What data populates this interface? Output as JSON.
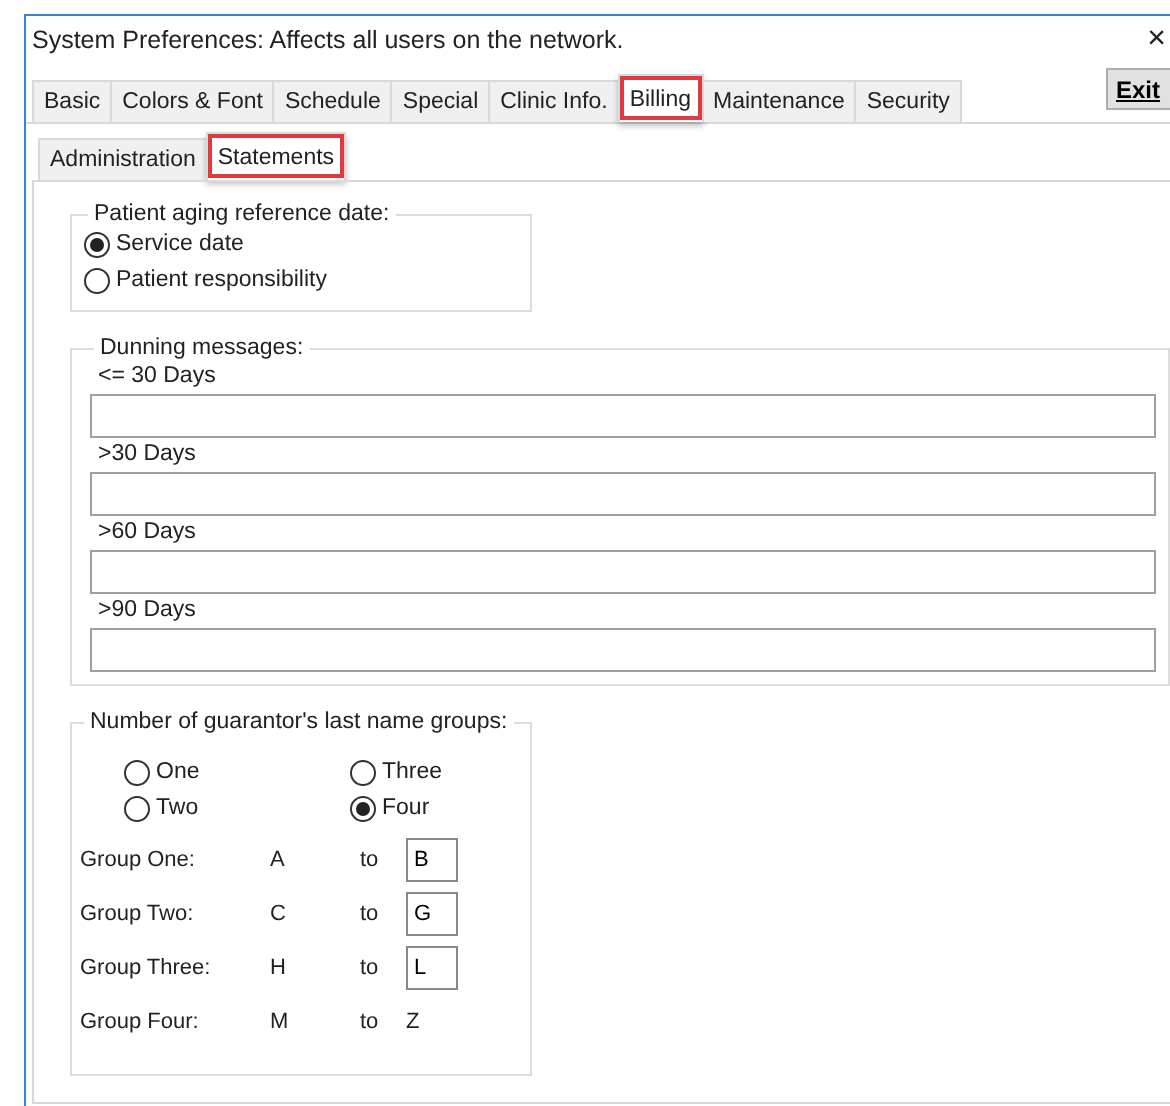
{
  "window": {
    "title": "System Preferences: Affects all users on the network.",
    "close": "×"
  },
  "tabs": [
    {
      "label": "Basic",
      "selected": false,
      "highlighted": false
    },
    {
      "label": "Colors & Font",
      "selected": false,
      "highlighted": false
    },
    {
      "label": "Schedule",
      "selected": false,
      "highlighted": false
    },
    {
      "label": "Special",
      "selected": false,
      "highlighted": false
    },
    {
      "label": "Clinic Info.",
      "selected": false,
      "highlighted": false
    },
    {
      "label": "Billing",
      "selected": true,
      "highlighted": true
    },
    {
      "label": "Maintenance",
      "selected": false,
      "highlighted": false
    },
    {
      "label": "Security",
      "selected": false,
      "highlighted": false
    }
  ],
  "exit_button": "Exit",
  "subtabs": [
    {
      "label": "Administration",
      "selected": false,
      "highlighted": false
    },
    {
      "label": "Statements",
      "selected": true,
      "highlighted": true
    }
  ],
  "aging": {
    "title": "Patient aging reference date:",
    "options": [
      {
        "label": "Service date",
        "selected": true
      },
      {
        "label": "Patient responsibility",
        "selected": false
      }
    ]
  },
  "dunning": {
    "title": "Dunning messages:",
    "messages": [
      {
        "label": "<= 30 Days"
      },
      {
        "label": ">30 Days"
      },
      {
        "label": ">60 Days"
      },
      {
        "label": ">90 Days"
      }
    ]
  },
  "groups": {
    "title": "Number of guarantor's last name groups:",
    "options": [
      {
        "label": "One",
        "selected": false
      },
      {
        "label": "Three",
        "selected": false
      },
      {
        "label": "Two",
        "selected": false
      },
      {
        "label": "Four",
        "selected": true
      }
    ],
    "rows": [
      {
        "label": "Group One:",
        "from": "A",
        "to_label": "to",
        "to": "B",
        "kind": "field"
      },
      {
        "label": "Group Two:",
        "from": "C",
        "to_label": "to",
        "to": "G",
        "kind": "field"
      },
      {
        "label": "Group Three:",
        "from": "H",
        "to_label": "to",
        "to": "L",
        "kind": "field"
      },
      {
        "label": "Group Four:",
        "from": "M",
        "to_label": "to",
        "to": "Z",
        "kind": "text"
      }
    ]
  }
}
